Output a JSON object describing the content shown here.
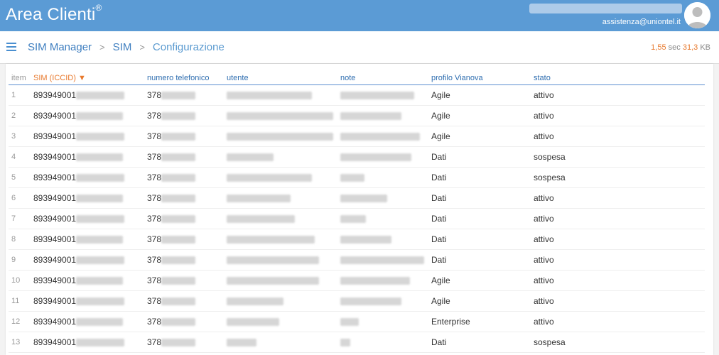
{
  "header": {
    "brand": "Area Clienti",
    "brand_mark": "®",
    "email": "assistenza@uniontel.it"
  },
  "breadcrumb": {
    "items": [
      "SIM Manager",
      "SIM",
      "Configurazione"
    ]
  },
  "stats": {
    "time": "1,55",
    "time_unit": "sec",
    "size": "31,3",
    "size_unit": "KB"
  },
  "table": {
    "columns": [
      "item",
      "SIM (ICCID)",
      "numero telefonico",
      "utente",
      "note",
      "profilo Vianova",
      "stato"
    ],
    "sort_indicator": "▼",
    "rows": [
      {
        "item": "1",
        "iccid": "893949001",
        "phone": "378",
        "profilo": "Agile",
        "stato": "attivo"
      },
      {
        "item": "2",
        "iccid": "893949001",
        "phone": "378",
        "profilo": "Agile",
        "stato": "attivo"
      },
      {
        "item": "3",
        "iccid": "893949001",
        "phone": "378",
        "profilo": "Agile",
        "stato": "attivo"
      },
      {
        "item": "4",
        "iccid": "893949001",
        "phone": "378",
        "profilo": "Dati",
        "stato": "sospesa"
      },
      {
        "item": "5",
        "iccid": "893949001",
        "phone": "378",
        "profilo": "Dati",
        "stato": "sospesa"
      },
      {
        "item": "6",
        "iccid": "893949001",
        "phone": "378",
        "profilo": "Dati",
        "stato": "attivo"
      },
      {
        "item": "7",
        "iccid": "893949001",
        "phone": "378",
        "profilo": "Dati",
        "stato": "attivo"
      },
      {
        "item": "8",
        "iccid": "893949001",
        "phone": "378",
        "profilo": "Dati",
        "stato": "attivo"
      },
      {
        "item": "9",
        "iccid": "893949001",
        "phone": "378",
        "profilo": "Dati",
        "stato": "attivo"
      },
      {
        "item": "10",
        "iccid": "893949001",
        "phone": "378",
        "profilo": "Agile",
        "stato": "attivo"
      },
      {
        "item": "11",
        "iccid": "893949001",
        "phone": "378",
        "profilo": "Agile",
        "stato": "attivo"
      },
      {
        "item": "12",
        "iccid": "893949001",
        "phone": "378",
        "profilo": "Enterprise",
        "stato": "attivo"
      },
      {
        "item": "13",
        "iccid": "893949001",
        "phone": "378",
        "profilo": "Dati",
        "stato": "sospesa"
      }
    ]
  }
}
